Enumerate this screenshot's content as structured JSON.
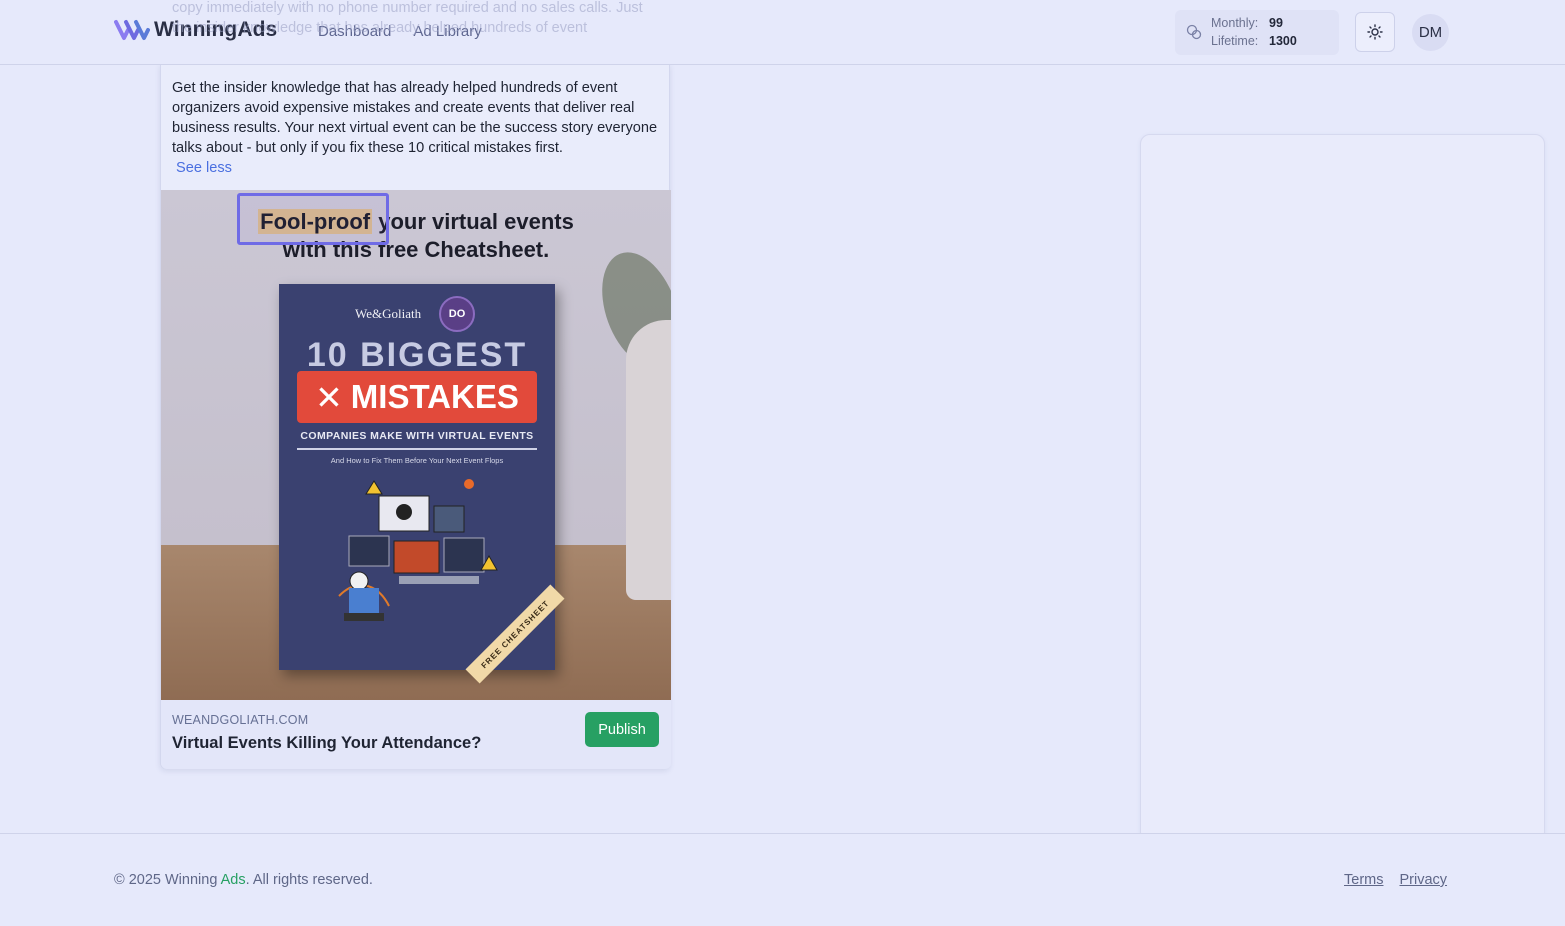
{
  "header": {
    "logo_text": "WinningAds",
    "nav": [
      "Dashboard",
      "Ad Library"
    ],
    "credits": {
      "monthly_label": "Monthly:",
      "monthly_value": "99",
      "lifetime_label": "Lifetime:",
      "lifetime_value": "1300"
    },
    "avatar_initials": "DM"
  },
  "ad": {
    "faded_copy": "copy immediately with no phone number required and no sales calls. Just the insider knowledge that has already helped hundreds of event",
    "body": "Get the insider knowledge that has already helped hundreds of event organizers avoid expensive mistakes and create events that deliver real business results. Your next virtual event can be the success story everyone talks about - but only if you fix these 10 critical mistakes first.",
    "see_less": "See less",
    "creative": {
      "headline_highlight": "Fool-proof",
      "headline_rest_line1": " your virtual events",
      "headline_line2": "with this free Cheatsheet.",
      "book_brand": "We&Goliath",
      "book_badge": "DO",
      "book_big": "10 BIGGEST",
      "book_mistakes": "MISTAKES",
      "book_mistakes_icon": "x-icon",
      "book_sub": "COMPANIES MAKE WITH VIRTUAL EVENTS",
      "book_tiny": "And How to Fix Them Before Your Next Event Flops",
      "book_ribbon": "FREE CHEATSHEET"
    },
    "domain": "WEANDGOLIATH.COM",
    "title": "Virtual Events Killing Your Attendance?",
    "publish_label": "Publish"
  },
  "footer": {
    "copyright_prefix": "© 2025 Winning ",
    "copyright_brand": "Ads",
    "copyright_suffix": ". All rights reserved.",
    "links": [
      "Terms",
      "Privacy"
    ]
  },
  "colors": {
    "accent_green": "#27a063",
    "selection_purple": "#6f6be6",
    "link_blue": "#4a6fe0"
  }
}
